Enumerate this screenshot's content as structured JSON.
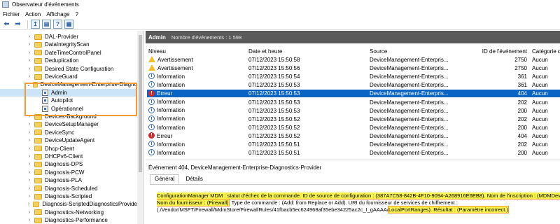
{
  "window": {
    "title": "Observateur d'événements"
  },
  "menu": [
    "Fichier",
    "Action",
    "Affichage",
    "?"
  ],
  "tree": {
    "items": [
      {
        "label": "DAL-Provider",
        "type": "folder"
      },
      {
        "label": "DataIntegrityScan",
        "type": "folder"
      },
      {
        "label": "DateTimeControlPanel",
        "type": "folder"
      },
      {
        "label": "Deduplication",
        "type": "folder"
      },
      {
        "label": "Desired State Configuration",
        "type": "folder"
      },
      {
        "label": "DeviceGuard",
        "type": "folder"
      },
      {
        "label": "DeviceManagement-Enterprise-Diagno",
        "type": "folder-open"
      },
      {
        "label": "Admin",
        "type": "log",
        "selected": true
      },
      {
        "label": "Autopilot",
        "type": "log"
      },
      {
        "label": "Opérationnel",
        "type": "log"
      },
      {
        "label": "Devices-Background",
        "type": "folder"
      },
      {
        "label": "DeviceSetupManager",
        "type": "folder"
      },
      {
        "label": "DeviceSync",
        "type": "folder"
      },
      {
        "label": "DeviceUpdateAgent",
        "type": "folder"
      },
      {
        "label": "Dhcp-Client",
        "type": "folder"
      },
      {
        "label": "DHCPv6-Client",
        "type": "folder"
      },
      {
        "label": "Diagnosis-DPS",
        "type": "folder"
      },
      {
        "label": "Diagnosis-PCW",
        "type": "folder"
      },
      {
        "label": "Diagnosis-PLA",
        "type": "folder"
      },
      {
        "label": "Diagnosis-Scheduled",
        "type": "folder"
      },
      {
        "label": "Diagnosis-Scripted",
        "type": "folder"
      },
      {
        "label": "Diagnosis-ScriptedDiagnosticsProvide",
        "type": "folder"
      },
      {
        "label": "Diagnostics-Networking",
        "type": "folder"
      },
      {
        "label": "Diagnostics-Performance",
        "type": "folder"
      }
    ]
  },
  "panel": {
    "title": "Admin",
    "count": "Nombre d'événements : 1 598"
  },
  "columns": [
    "Niveau",
    "Date et heure",
    "Source",
    "ID de l'événement",
    "Catégorie de"
  ],
  "rows": [
    {
      "level": "Avertissement",
      "icon": "warning-icon",
      "date": "07/12/2023 15:50:58",
      "source": "DeviceManagement-Enterpris...",
      "id": "2750",
      "cat": "Aucun"
    },
    {
      "level": "Avertissement",
      "icon": "warning-icon",
      "date": "07/12/2023 15:50:56",
      "source": "DeviceManagement-Enterpris...",
      "id": "2750",
      "cat": "Aucun"
    },
    {
      "level": "Information",
      "icon": "info-icon",
      "date": "07/12/2023 15:50:54",
      "source": "DeviceManagement-Enterpris...",
      "id": "361",
      "cat": "Aucun"
    },
    {
      "level": "Information",
      "icon": "info-icon",
      "date": "07/12/2023 15:50:53",
      "source": "DeviceManagement-Enterpris...",
      "id": "361",
      "cat": "Aucun"
    },
    {
      "level": "Erreur",
      "icon": "error-icon",
      "date": "07/12/2023 15:50:53",
      "source": "DeviceManagement-Enterpris...",
      "id": "404",
      "cat": "Aucun",
      "selected": true
    },
    {
      "level": "Information",
      "icon": "info-icon",
      "date": "07/12/2023 15:50:53",
      "source": "DeviceManagement-Enterpris...",
      "id": "202",
      "cat": "Aucun"
    },
    {
      "level": "Information",
      "icon": "info-icon",
      "date": "07/12/2023 15:50:53",
      "source": "DeviceManagement-Enterpris...",
      "id": "200",
      "cat": "Aucun"
    },
    {
      "level": "Information",
      "icon": "info-icon",
      "date": "07/12/2023 15:50:52",
      "source": "DeviceManagement-Enterpris...",
      "id": "202",
      "cat": "Aucun"
    },
    {
      "level": "Information",
      "icon": "info-icon",
      "date": "07/12/2023 15:50:52",
      "source": "DeviceManagement-Enterpris...",
      "id": "200",
      "cat": "Aucun"
    },
    {
      "level": "Erreur",
      "icon": "error-icon",
      "date": "07/12/2023 15:50:52",
      "source": "DeviceManagement-Enterpris...",
      "id": "404",
      "cat": "Aucun"
    },
    {
      "level": "Information",
      "icon": "info-icon",
      "date": "07/12/2023 15:50:51",
      "source": "DeviceManagement-Enterpris...",
      "id": "202",
      "cat": "Aucun"
    },
    {
      "level": "Information",
      "icon": "info-icon",
      "date": "07/12/2023 15:50:51",
      "source": "DeviceManagement-Enterpris...",
      "id": "200",
      "cat": "Aucun"
    }
  ],
  "details": {
    "event_title": "Événement 404, DeviceManagement-Enterprise-Diagnostics-Provider",
    "tabs": [
      "Général",
      "Détails"
    ],
    "line1": "ConfigurationManager MDM : statut d'échec de la commande. ID de source de configuration : (387A7C58-842B-4F10-9094-A268916E6EB8). Nom de l'inscription : (MDMDev",
    "line2_hl": "Nom du fournisseur : (Firewall)",
    "line2_rest": ". Type de commande : (Add: from Replace or Add). URI du fournisseur de services de chiffrement :",
    "line3_a": "(./Vendor/MSFT/Firewall/MdmStore/FirewallRules/41fbacb5ec624968af35ebe34225ac2c_I_gAAAA/",
    "line3_hl1": "LocalPortRanges). Résultat : (Paramètre incorrect.)",
    "line3_end": "."
  },
  "colors": {
    "accent": "#0a64c4",
    "highlight": "#f7f34a",
    "frame": "#f39a35"
  }
}
